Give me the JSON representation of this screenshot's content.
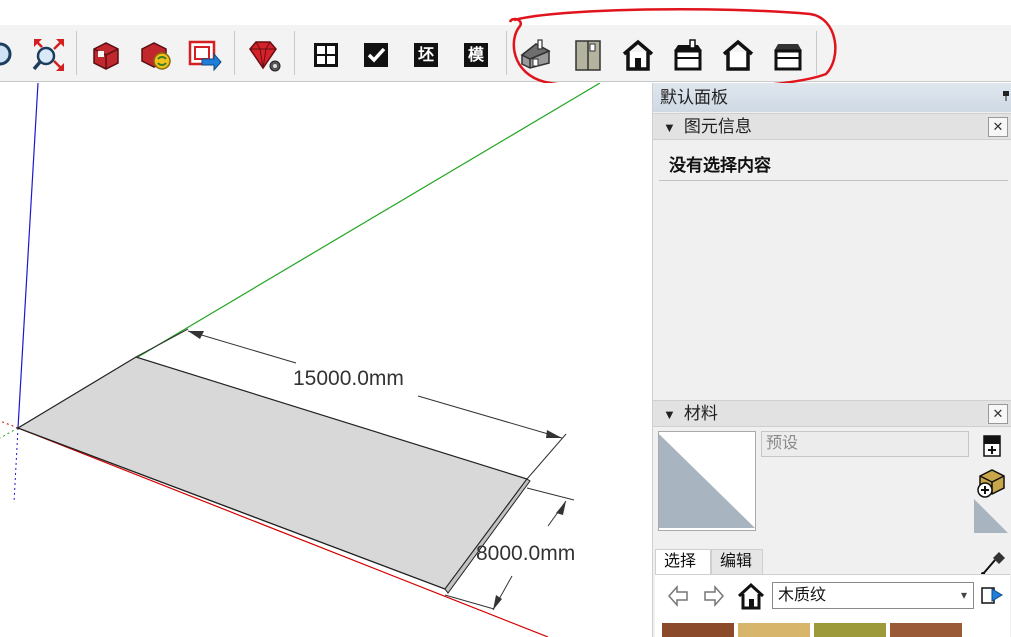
{
  "tray": {
    "title": "默认面板",
    "entity_panel": {
      "title": "图元信息",
      "empty_text": "没有选择内容"
    },
    "materials_panel": {
      "title": "材料",
      "material_name_placeholder": "预设",
      "tabs": {
        "select": "选择",
        "edit": "编辑"
      },
      "library": "木质纹"
    }
  },
  "toolbar": {
    "text_buttons": [
      "坯",
      "模"
    ]
  },
  "dimensions": {
    "length": "15000.0mm",
    "width": "8000.0mm"
  },
  "colors": {
    "annotation_red": "#e0141c",
    "axis_red": "#d40000",
    "axis_green": "#1fa51f",
    "axis_blue": "#1a1acc",
    "face": "#d8d8d8"
  },
  "icons": {
    "close": "close-icon",
    "pin": "pin-icon"
  }
}
